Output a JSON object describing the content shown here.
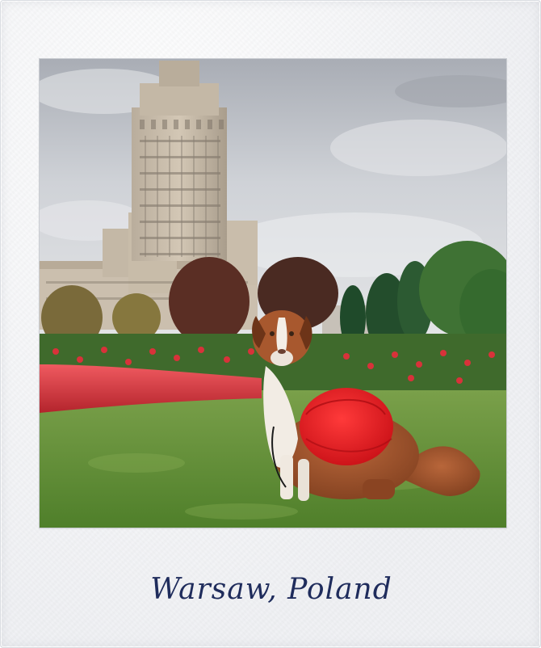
{
  "caption": "Warsaw, Poland",
  "colors": {
    "ink": "#1f2c5c",
    "frame": "#eef0f3",
    "sky": "#c9ccd2",
    "grass": "#5f8f32",
    "flowers_red": "#d83a3f",
    "backpack": "#e0161c",
    "dog_fur": "#a9562c"
  },
  "scene": {
    "subjects": [
      "palace-tower",
      "side-buildings",
      "trees",
      "red-flower-bed",
      "rose-hedge",
      "grass-lawn",
      "dog",
      "red-backpack"
    ]
  }
}
